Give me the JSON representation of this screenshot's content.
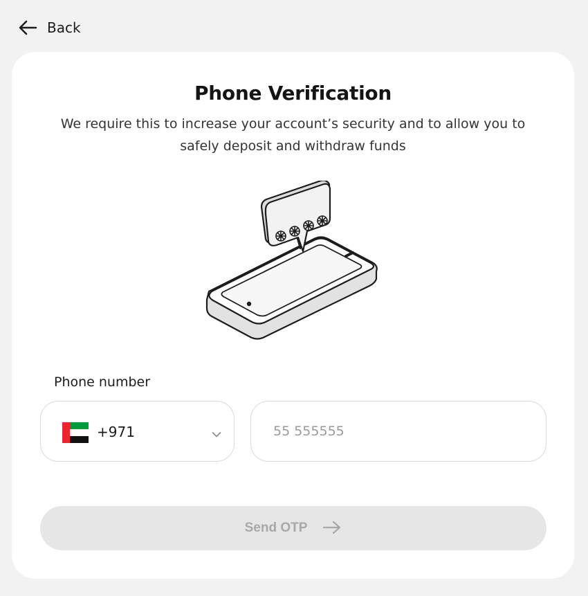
{
  "header": {
    "back_label": "Back",
    "back_icon": "arrow-left-icon"
  },
  "card": {
    "title": "Phone Verification",
    "subtitle": "We require this to increase your account’s security and to allow you to safely deposit and withdraw funds",
    "illustration": "phone-otp-message-illustration"
  },
  "form": {
    "phone_label": "Phone number",
    "country": {
      "flag": "uae-flag",
      "dial_code": "+971",
      "dropdown_icon": "chevron-down-icon"
    },
    "phone_input": {
      "value": "",
      "placeholder": "55 555555"
    },
    "submit": {
      "label": "Send OTP",
      "icon": "arrow-right-icon",
      "disabled": true
    }
  },
  "colors": {
    "page_background": "#f2f2f2",
    "card_background": "#ffffff",
    "button_disabled_bg": "#e6e6e6",
    "button_disabled_text": "#a8a8a8",
    "flag_red": "#e8262c",
    "flag_green": "#009a3e",
    "flag_black": "#111111"
  }
}
